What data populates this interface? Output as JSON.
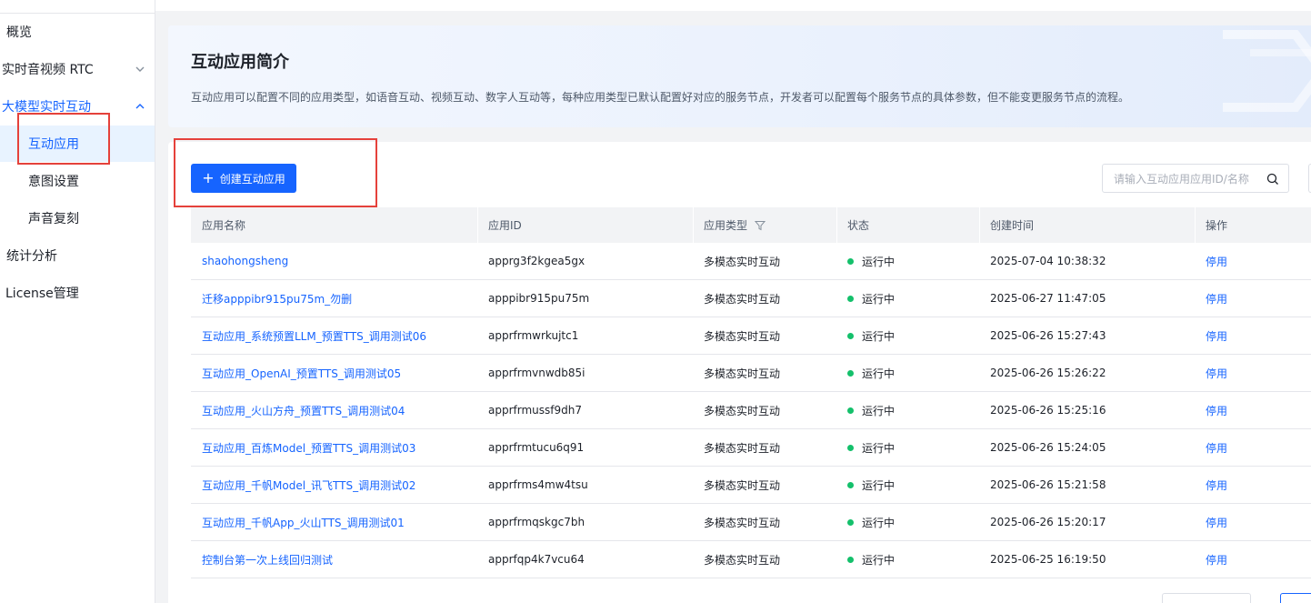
{
  "sidebar": {
    "items": [
      {
        "label": "概览"
      },
      {
        "label": "实时音视频 RTC"
      },
      {
        "label": "大模型实时互动"
      },
      {
        "label": "互动应用"
      },
      {
        "label": "意图设置"
      },
      {
        "label": "声音复刻"
      },
      {
        "label": "统计分析"
      },
      {
        "label": "License管理"
      }
    ]
  },
  "intro": {
    "title": "互动应用简介",
    "description": "互动应用可以配置不同的应用类型，如语音互动、视频互动、数字人互动等，每种应用类型已默认配置好对应的服务节点，开发者可以配置每个服务节点的具体参数，但不能变更服务节点的流程。"
  },
  "toolbar": {
    "create_label": "创建互动应用",
    "search_placeholder": "请输入互动应用应用ID/名称"
  },
  "table": {
    "headers": [
      "应用名称",
      "应用ID",
      "应用类型",
      "状态",
      "创建时间",
      "操作"
    ],
    "rows": [
      {
        "name": "shaohongsheng",
        "id": "apprg3f2kgea5gx",
        "type": "多模态实时互动",
        "status": "运行中",
        "created": "2025-07-04 10:38:32",
        "action": "停用"
      },
      {
        "name": "迁移apppibr915pu75m_勿删",
        "id": "apppibr915pu75m",
        "type": "多模态实时互动",
        "status": "运行中",
        "created": "2025-06-27 11:47:05",
        "action": "停用"
      },
      {
        "name": "互动应用_系统预置LLM_预置TTS_调用测试06",
        "id": "apprfrmwrkujtc1",
        "type": "多模态实时互动",
        "status": "运行中",
        "created": "2025-06-26 15:27:43",
        "action": "停用"
      },
      {
        "name": "互动应用_OpenAI_预置TTS_调用测试05",
        "id": "apprfrmvnwdb85i",
        "type": "多模态实时互动",
        "status": "运行中",
        "created": "2025-06-26 15:26:22",
        "action": "停用"
      },
      {
        "name": "互动应用_火山方舟_预置TTS_调用测试04",
        "id": "apprfrmussf9dh7",
        "type": "多模态实时互动",
        "status": "运行中",
        "created": "2025-06-26 15:25:16",
        "action": "停用"
      },
      {
        "name": "互动应用_百炼Model_预置TTS_调用测试03",
        "id": "apprfrmtucu6q91",
        "type": "多模态实时互动",
        "status": "运行中",
        "created": "2025-06-26 15:24:05",
        "action": "停用"
      },
      {
        "name": "互动应用_千帆Model_讯飞TTS_调用测试02",
        "id": "apprfrms4mw4tsu",
        "type": "多模态实时互动",
        "status": "运行中",
        "created": "2025-06-26 15:21:58",
        "action": "停用"
      },
      {
        "name": "互动应用_千帆App_火山TTS_调用测试01",
        "id": "apprfrmqskgc7bh",
        "type": "多模态实时互动",
        "status": "运行中",
        "created": "2025-06-26 15:20:17",
        "action": "停用"
      },
      {
        "name": "控制台第一次上线回归测试",
        "id": "apprfqp4k7vcu64",
        "type": "多模态实时互动",
        "status": "运行中",
        "created": "2025-06-25 16:19:50",
        "action": "停用"
      }
    ]
  },
  "colors": {
    "accent": "#1664ff",
    "status_running": "#14c06b",
    "highlight": "#e5413b"
  },
  "icons": [
    "chevron-down-icon",
    "chevron-up-icon",
    "plus-icon",
    "search-icon",
    "filter-icon"
  ]
}
